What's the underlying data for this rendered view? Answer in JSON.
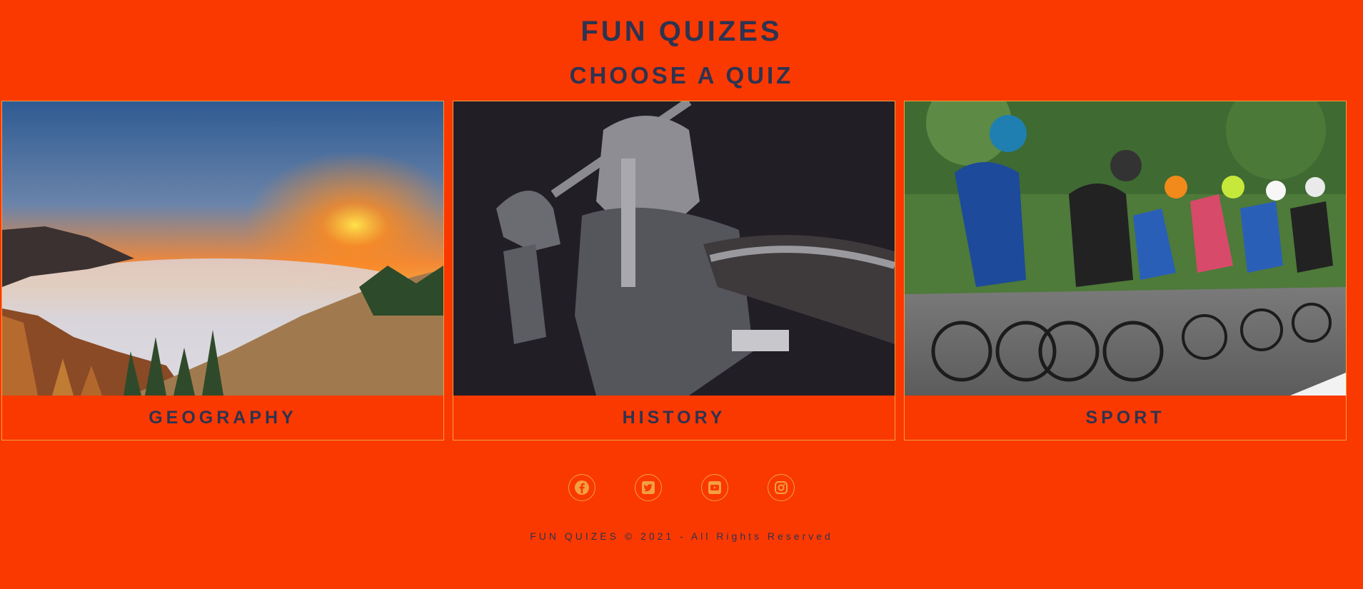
{
  "header": {
    "title": "FUN QUIZES",
    "subtitle": "CHOOSE A QUIZ"
  },
  "quizzes": [
    {
      "label": "GEOGRAPHY",
      "image": "sunset-over-clouds-mountain-photo"
    },
    {
      "label": "HISTORY",
      "image": "medieval-knight-with-sword-photo"
    },
    {
      "label": "SPORT",
      "image": "road-cyclists-peloton-photo"
    }
  ],
  "socials": [
    {
      "icon": "facebook-icon"
    },
    {
      "icon": "twitter-icon"
    },
    {
      "icon": "youtube-icon"
    },
    {
      "icon": "instagram-icon"
    }
  ],
  "footer": {
    "copyright": "FUN QUIZES © 2021 - All Rights Reserved"
  },
  "colors": {
    "background": "#fa3900",
    "text": "#2e3350",
    "border": "#f3a040"
  }
}
